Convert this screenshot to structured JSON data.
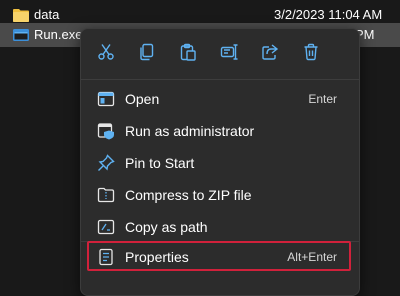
{
  "files": [
    {
      "name": "data",
      "icon": "folder-icon",
      "modified": "3/2/2023 11:04 AM"
    },
    {
      "name": "Run.exe",
      "icon": "application-icon",
      "modified_partial": "PM"
    }
  ],
  "context_menu": {
    "toolbar": [
      {
        "name": "cut-icon",
        "tooltip": ""
      },
      {
        "name": "copy-icon",
        "tooltip": ""
      },
      {
        "name": "paste-icon",
        "tooltip": ""
      },
      {
        "name": "rename-icon",
        "tooltip": ""
      },
      {
        "name": "share-icon",
        "tooltip": ""
      },
      {
        "name": "delete-icon",
        "tooltip": ""
      }
    ],
    "items": [
      {
        "label": "Open",
        "shortcut": "Enter",
        "icon": "open-window-icon"
      },
      {
        "label": "Run as administrator",
        "shortcut": "",
        "icon": "shield-admin-icon"
      },
      {
        "label": "Pin to Start",
        "shortcut": "",
        "icon": "pin-icon"
      },
      {
        "label": "Compress to ZIP file",
        "shortcut": "",
        "icon": "zip-folder-icon"
      },
      {
        "label": "Copy as path",
        "shortcut": "",
        "icon": "copy-path-icon"
      },
      {
        "label": "Properties",
        "shortcut": "Alt+Enter",
        "icon": "properties-icon",
        "highlighted": true
      }
    ]
  },
  "colors": {
    "accent_blue": "#5fb2f2",
    "highlight_red": "#d1213b",
    "menu_bg": "#2c2c2c",
    "folder_yellow": "#f0c040"
  }
}
